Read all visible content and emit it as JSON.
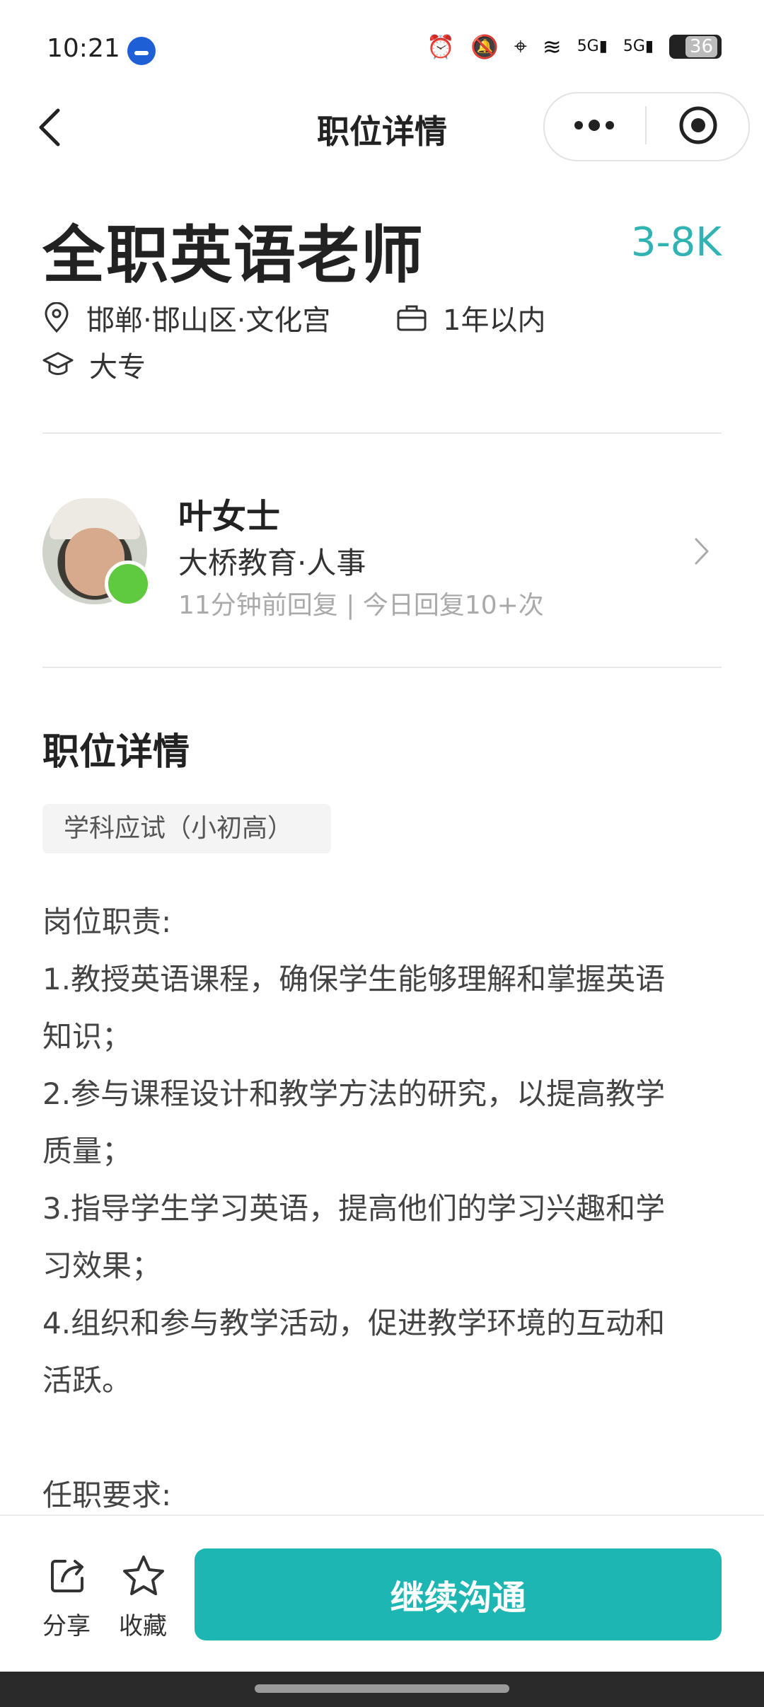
{
  "status_bar": {
    "time": "10:21",
    "network_1": "5G",
    "network_2": "5G",
    "battery": "36"
  },
  "nav": {
    "title": "职位详情"
  },
  "job": {
    "title": "全职英语老师",
    "salary": "3-8K",
    "location": "邯郸·邯山区·文化宫",
    "experience": "1年以内",
    "education": "大专"
  },
  "recruiter": {
    "name": "叶女士",
    "company": "大桥教育·人事",
    "reply": "11分钟前回复 | 今日回复10+次"
  },
  "details": {
    "section_title": "职位详情",
    "tag": "学科应试（小初高）",
    "description": "岗位职责:\n1.教授英语课程，确保学生能够理解和掌握英语\n知识；\n2.参与课程设计和教学方法的研究，以提高教学\n质量；\n3.指导学生学习英语，提高他们的学习兴趣和学\n习效果；\n4.组织和参与教学活动，促进教学环境的互动和\n活跃。\n\n任职要求:"
  },
  "bottom_bar": {
    "share_label": "分享",
    "favorite_label": "收藏",
    "cta_label": "继续沟通"
  },
  "colors": {
    "accent": "#1db6b3",
    "salary": "#32b3b3",
    "online": "#5fc93f"
  }
}
